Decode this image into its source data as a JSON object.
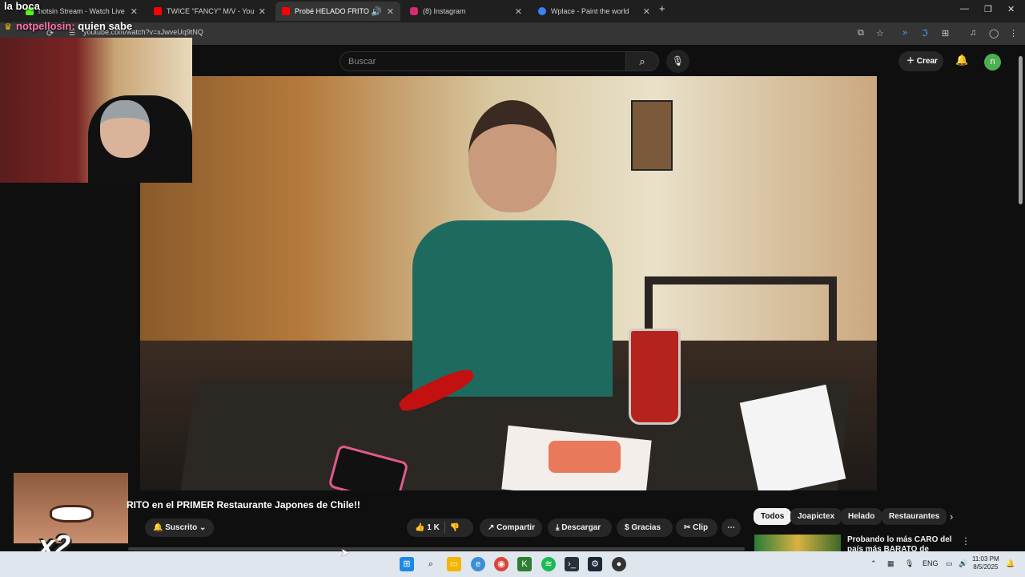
{
  "browser": {
    "tabs": [
      {
        "label": "notsin Stream - Watch Live on ",
        "color": "#53fc18"
      },
      {
        "label": "TWICE \"FANCY\" M/V - YouTube",
        "color": "#ff0000"
      },
      {
        "label": "Probé HELADO FRITO en el",
        "color": "#ff0000"
      },
      {
        "label": "(8) Instagram",
        "color": "#d62976"
      },
      {
        "label": "Wplace - Paint the world",
        "color": "#3b82f6"
      }
    ],
    "url": "youtube.com/watch?v=xJwveUq9tNQ"
  },
  "youtube": {
    "search_placeholder": "Buscar",
    "create_label": "Crear",
    "avatar_letter": "n",
    "video_title": "RITO en el PRIMER Restaurante Japones de Chile!!",
    "subscribe_label": "Suscrito",
    "likes": "1 K",
    "share_label": "Compartir",
    "download_label": "Descargar",
    "thanks_label": "Gracias",
    "clip_label": "Clip",
    "chips": [
      "Todos",
      "Joapictex",
      "Helado",
      "Restaurantes"
    ],
    "recommended": [
      {
        "title": "Probando lo más CARO del país más BARATO de SUDAMÉRIC..."
      }
    ]
  },
  "overlay": {
    "chat_line1": "la boca",
    "chat_user": "notpellosin:",
    "chat_message": "quien sabe",
    "emote_multiplier": "x2"
  },
  "taskbar": {
    "language": "ENG",
    "time": "11:03 PM",
    "date": "8/5/2025"
  }
}
